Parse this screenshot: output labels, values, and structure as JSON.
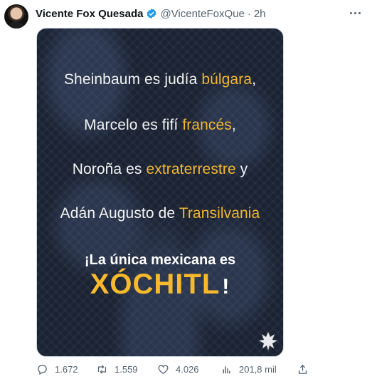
{
  "tweet": {
    "author": {
      "name": "Vicente Fox Quesada",
      "handle": "@VicenteFoxQue",
      "separator": "·",
      "time": "2h"
    },
    "image": {
      "line1_a": "Sheinbaum es judía ",
      "line1_b": "búlgara",
      "line1_c": ",",
      "line2_a": "Marcelo es fifí ",
      "line2_b": "francés",
      "line2_c": ",",
      "line3_a": "Noroña es ",
      "line3_b": "extraterrestre",
      "line3_c": " y",
      "line4_a": "Adán Augusto de ",
      "line4_b": "Transilvania",
      "cta": "¡La única mexicana es",
      "big_name": "XÓCHITL",
      "big_bang": "!"
    },
    "metrics": {
      "replies": "1.672",
      "retweets": "1.559",
      "likes": "4.026",
      "views": "201,8 mil"
    }
  }
}
